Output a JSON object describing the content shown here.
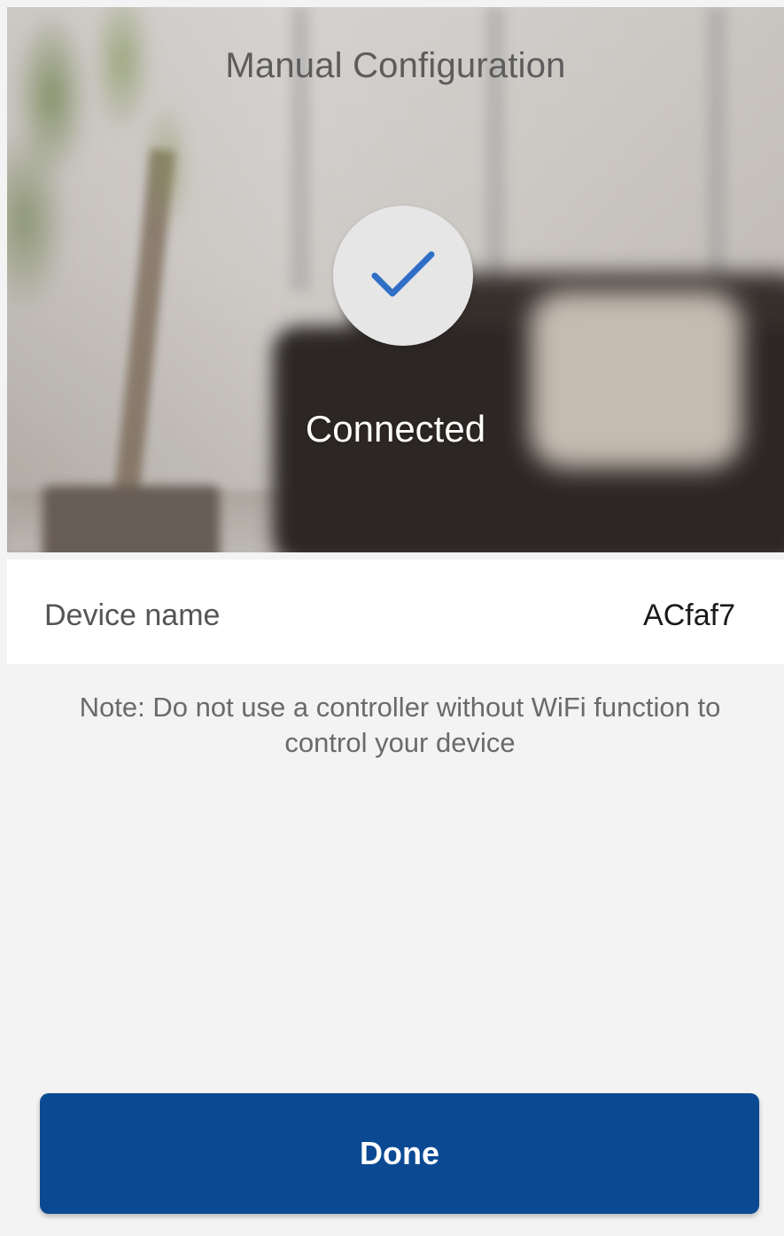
{
  "header": {
    "title": "Manual Configuration"
  },
  "status": {
    "icon": "check-icon",
    "text": "Connected",
    "check_color": "#2f6fc6"
  },
  "device": {
    "label": "Device name",
    "value": "ACfaf7"
  },
  "note": {
    "text": "Note: Do not use a controller without WiFi function to control your device"
  },
  "actions": {
    "done_label": "Done",
    "primary_color": "#0b4a93"
  }
}
